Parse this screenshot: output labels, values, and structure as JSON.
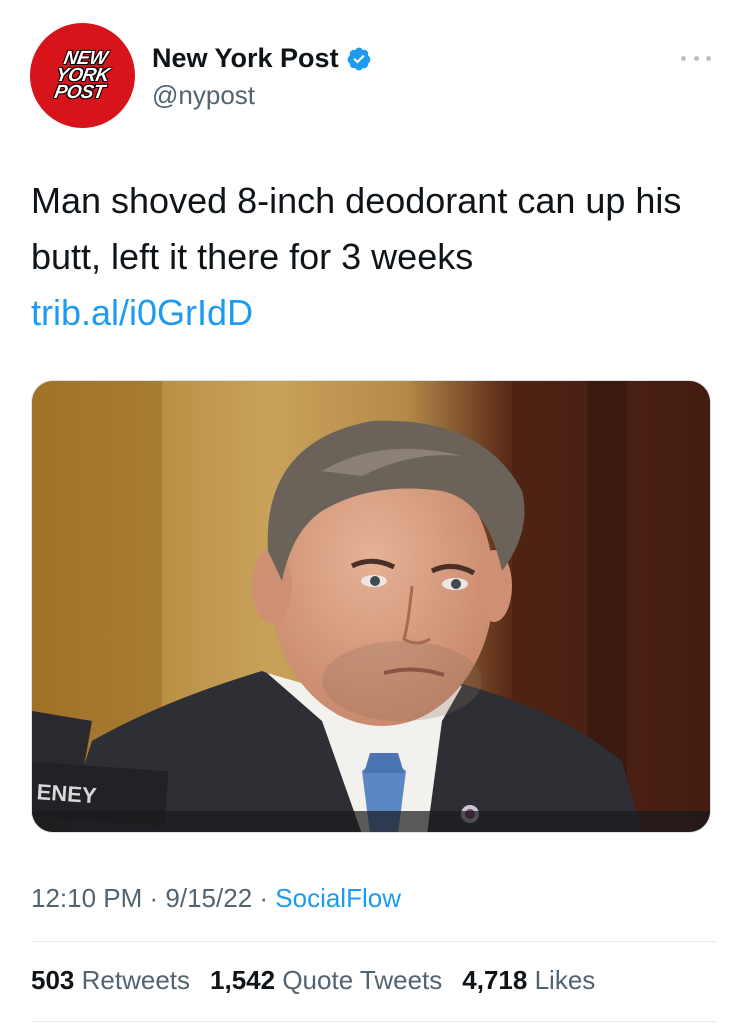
{
  "author": {
    "avatar_logo_lines": [
      "NEW",
      "YORK",
      "POST"
    ],
    "display_name": "New York Post",
    "handle": "@nypost",
    "verified": true,
    "brand_color": "#d7141a"
  },
  "tweet": {
    "text": "Man shoved 8-inch deodorant can up his butt, left it there for 3 weeks",
    "link": "trib.al/i0GrIdD",
    "image_nameplate_text": "ENEY"
  },
  "meta": {
    "time": "12:10 PM",
    "separator": " · ",
    "date": "9/15/22",
    "source": "SocialFlow"
  },
  "stats": [
    {
      "count": "503",
      "label": "Retweets"
    },
    {
      "count": "1,542",
      "label": "Quote Tweets"
    },
    {
      "count": "4,718",
      "label": "Likes"
    }
  ],
  "colors": {
    "link": "#1d9bf0",
    "secondary_text": "#536471",
    "verified_badge": "#1d9bf0"
  },
  "icons": [
    "verified-badge-icon",
    "more-options-icon"
  ]
}
